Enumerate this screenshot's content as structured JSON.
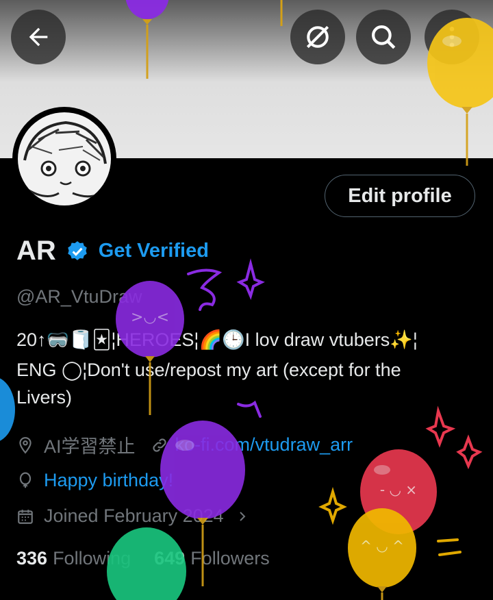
{
  "header": {
    "back_icon": "arrow-left-icon",
    "icons": [
      "no-signal-icon",
      "search-icon",
      "more-icon"
    ]
  },
  "profile": {
    "name": "AR",
    "get_verified": "Get Verified",
    "handle": "@AR_VtuDraw",
    "edit_profile": "Edit profile",
    "bio_lines": [
      "20↑🥽🧻🃏¦HEROES¦🌈🕒I lov draw vtubers✨¦",
      "ENG ◯¦Don't use/repost my art (except for the",
      "Livers)"
    ],
    "location": "AI学習禁止",
    "website": "ko-fi.com/vtudraw_arr",
    "birthday": "Happy birthday!",
    "joined": "Joined February 2024",
    "following_count": "336",
    "following_label": "Following",
    "followers_count": "649",
    "followers_label": "Followers"
  },
  "colors": {
    "accent": "#1d9bf0",
    "secondary_text": "#71767b",
    "primary_text": "#e7e9ea",
    "background": "#000000"
  }
}
